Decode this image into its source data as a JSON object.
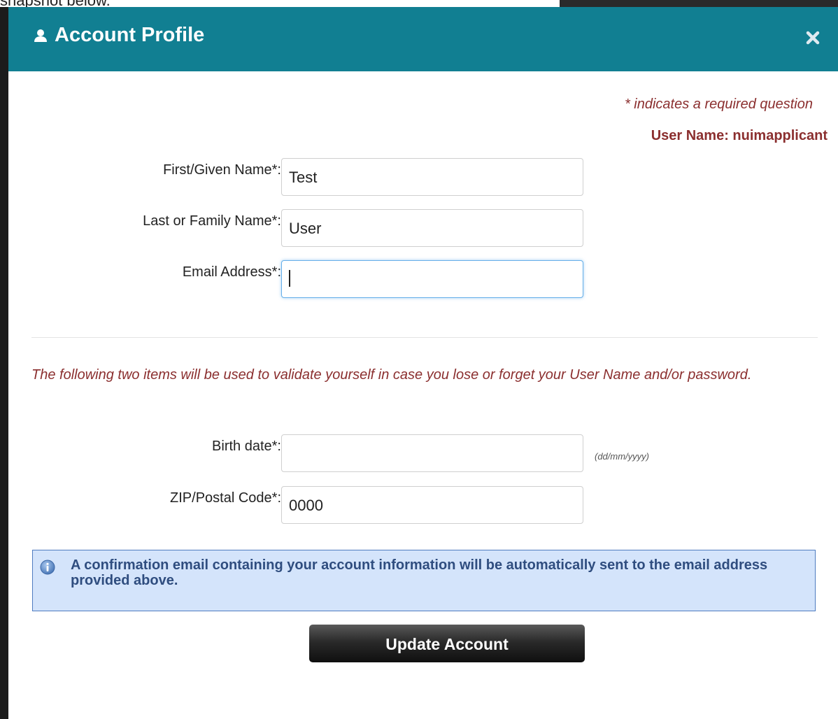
{
  "backdrop": {
    "text": "snapshot below."
  },
  "modal": {
    "title": "Account Profile",
    "required_note": "* indicates a required question",
    "username_line": "User Name: nuimapplicant",
    "fields": {
      "first_name": {
        "label": "First/Given Name*:",
        "value": "Test"
      },
      "last_name": {
        "label": "Last or Family Name*:",
        "value": "User"
      },
      "email": {
        "label": "Email Address*:",
        "value": ""
      },
      "birth_date": {
        "label": "Birth date*:",
        "value": "",
        "hint": "(dd/mm/yyyy)"
      },
      "zip": {
        "label": "ZIP/Postal Code*:",
        "value": "0000"
      }
    },
    "validate_note": "The following two items will be used to validate yourself in case you lose or forget your User Name and/or password.",
    "info_text": "A confirmation email containing your account information will be automatically sent to the email address provided above.",
    "update_button": "Update Account"
  },
  "icons": {
    "user": "user-icon",
    "close": "close-icon",
    "info": "info-icon"
  },
  "colors": {
    "header": "#117f92",
    "accent_text": "#8b2f2f",
    "info_bg": "#d4e4fb",
    "info_border": "#4f7cc0",
    "info_text": "#2f4d7f"
  }
}
